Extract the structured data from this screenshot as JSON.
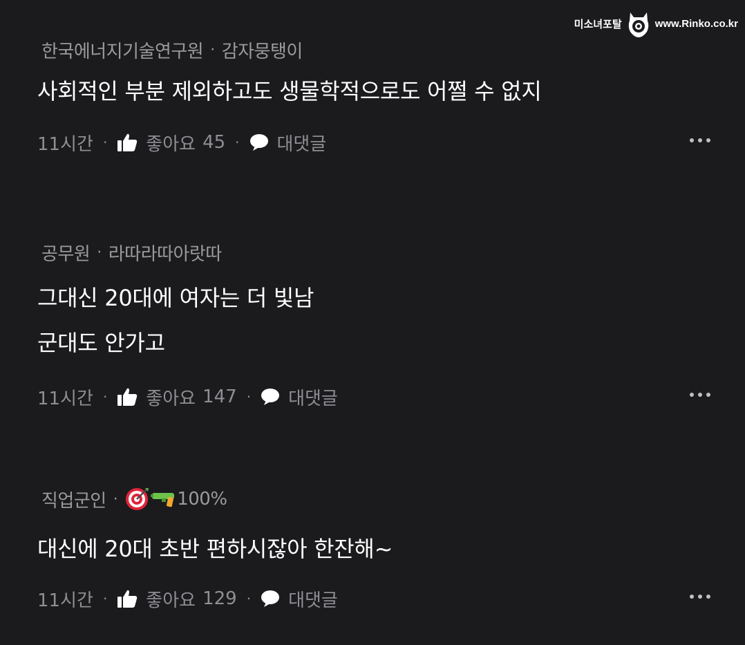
{
  "watermark": {
    "left": "미소녀포탈",
    "right": "www.Rinko.co.kr"
  },
  "icons": {
    "like": "thumbs-up-icon",
    "reply": "speech-bubble-icon",
    "more": "more-dots-icon"
  },
  "colors": {
    "background": "#1b1b1d",
    "meta": "#9a9a9e",
    "body": "#ffffff"
  },
  "comments": [
    {
      "company": "한국에너지기술연구원",
      "nickname": "감자뭉탱이",
      "lines": [
        "사회적인 부분 제외하고도 생물학적으로도 어쩔 수 없지"
      ],
      "time": "11시간",
      "like_label": "좋아요",
      "likes": "45",
      "reply_label": "대댓글"
    },
    {
      "company": "공무원",
      "nickname": "라따라따아랏따",
      "lines": [
        "그대신 20대에 여자는 더 빛남",
        "군대도 안가고"
      ],
      "time": "11시간",
      "like_label": "좋아요",
      "likes": "147",
      "reply_label": "대댓글"
    },
    {
      "company": "직업군인",
      "nickname": "100%",
      "nickname_emoji": [
        "target-icon",
        "water-gun-icon"
      ],
      "lines": [
        "대신에 20대 초반 편하시잖아 한잔해~"
      ],
      "time": "11시간",
      "like_label": "좋아요",
      "likes": "129",
      "reply_label": "대댓글"
    }
  ]
}
